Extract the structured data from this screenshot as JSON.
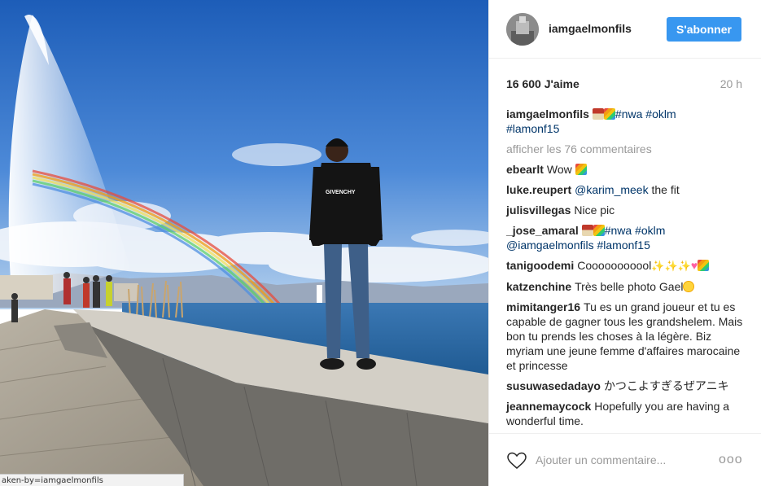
{
  "photo": {
    "status_url": "aken-by=iamgaelmonfils",
    "shirt_text": "GIVENCHY",
    "colors": {
      "sky_top": "#1d5db8",
      "sky_bottom": "#a8c8ea",
      "lake": "#2c6aa0",
      "wall": "#8f8f8a",
      "boardwalk": "#a59f93"
    }
  },
  "header": {
    "username": "iamgaelmonfils",
    "follow_label": "S'abonner"
  },
  "stats": {
    "likes": "16 600 J'aime",
    "time": "20 h"
  },
  "caption": {
    "user": "iamgaelmonfils",
    "tag1": "#nwa",
    "tag2": "#oklm",
    "tag3": "#lamonf15"
  },
  "view_all": "afficher les 76 commentaires",
  "comments": [
    {
      "user": "ebearlt",
      "text": "Wow"
    },
    {
      "user": "luke.reupert",
      "mention": "@karim_meek",
      "text": " the fit"
    },
    {
      "user": "julisvillegas",
      "text": "Nice pic"
    },
    {
      "user": "_jose_amaral",
      "tag1": "#nwa",
      "tag2": "#oklm",
      "mention": "@iamgaelmonfils",
      "tag3": "#lamonf15"
    },
    {
      "user": "tanigoodemi",
      "text": "Cooooooooool"
    },
    {
      "user": "katzenchine",
      "text": "Très belle photo Gael"
    },
    {
      "user": "mimitanger16",
      "text": "Tu es un grand joueur et tu es capable de gagner tous les grandshelem. Mais bon tu prends les choses à la légère. Biz myriam une jeune femme d'affaires marocaine et princesse"
    },
    {
      "user": "susuwasedadayo",
      "text": "かつこよすぎるぜアニキ"
    },
    {
      "user": "jeannemaycock",
      "text": "Hopefully you are having a wonderful time."
    }
  ],
  "footer": {
    "comment_placeholder": "Ajouter un commentaire...",
    "more_label": "ooo",
    "accent_color": "#3897f0"
  }
}
